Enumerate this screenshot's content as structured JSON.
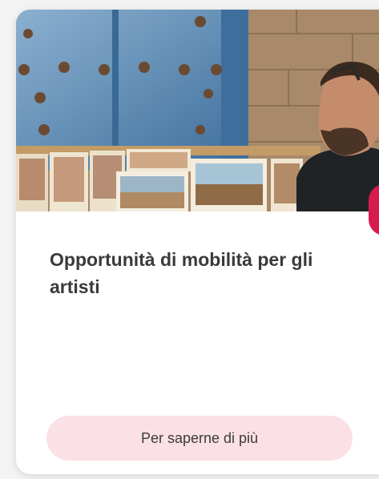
{
  "card": {
    "image_alt": "artist-selling-watercolor-paintings",
    "title": "Opportunità di mobilità per gli artisti",
    "cta_label": "Per saperne di più"
  },
  "colors": {
    "accent": "#d81b4f",
    "button_bg": "#fbe0e6",
    "door_blue": "#4d86b7",
    "wall": "#a88a6a"
  }
}
